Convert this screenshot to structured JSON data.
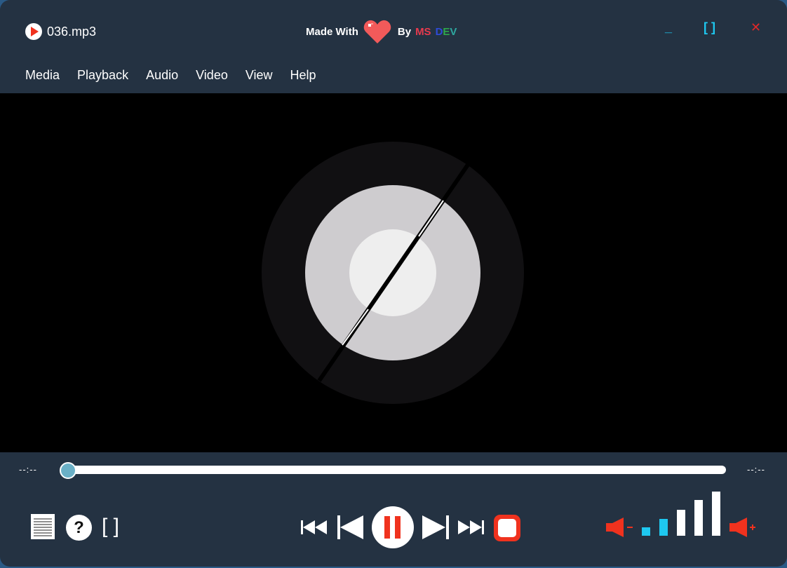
{
  "window": {
    "file_name": "036.mp3",
    "credit": {
      "made_with": "Made With",
      "by": "By",
      "ms": "MS",
      "d": "D",
      "e": "E",
      "v": "V"
    },
    "minimize_label": "_",
    "maximize_label": "[ ]",
    "close_label": "✕"
  },
  "menu": {
    "items": [
      {
        "label": "Media"
      },
      {
        "label": "Playback"
      },
      {
        "label": "Audio"
      },
      {
        "label": "Video"
      },
      {
        "label": "View"
      },
      {
        "label": "Help"
      }
    ]
  },
  "seek": {
    "elapsed": "--:--",
    "total": "--:--",
    "progress": 0.0
  },
  "controls": {
    "fullscreen_label": "[ ]",
    "help_label": "?"
  },
  "volume": {
    "bars_active": 2,
    "bars_total": 5
  },
  "colors": {
    "window_bg": "#243242",
    "accent_red": "#f0321e",
    "accent_cyan": "#1ec8f0",
    "seek_thumb": "#6ab0c6",
    "ms_color": "#e83a4e",
    "d_color": "#2e4bd8",
    "e_color": "#2ea84b",
    "v_color": "#2ea8a0"
  },
  "icons": {
    "app": "play-circle-icon",
    "heart": "heart-icon",
    "playlist": "playlist-icon",
    "help": "help-icon",
    "fullscreen": "fullscreen-icon",
    "rewind": "rewind-icon",
    "previous": "skip-previous-icon",
    "pause": "pause-icon",
    "next": "skip-next-icon",
    "fast_forward": "fast-forward-icon",
    "stop": "stop-icon",
    "volume_down": "volume-down-icon",
    "volume_up": "volume-up-icon"
  }
}
